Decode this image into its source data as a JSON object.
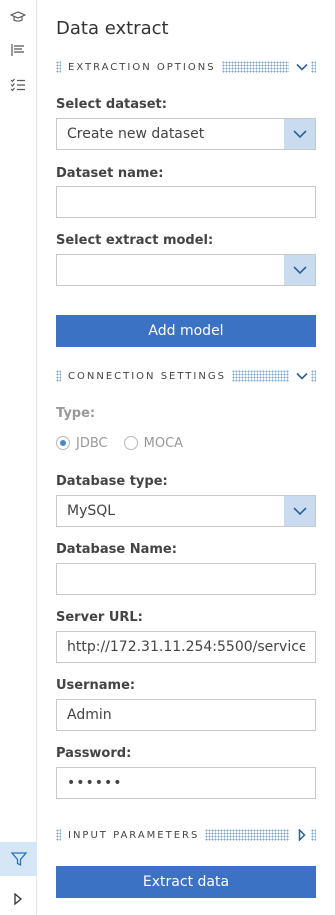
{
  "rail": {
    "icons": [
      "graduation-cap-icon",
      "list-flag-icon",
      "checklist-icon"
    ],
    "active": "filter-icon",
    "bottom": "play-icon"
  },
  "panel": {
    "title": "Data extract"
  },
  "extraction_options": {
    "header": "EXTRACTION OPTIONS",
    "select_dataset_label": "Select dataset:",
    "select_dataset_value": "Create new dataset",
    "dataset_name_label": "Dataset name:",
    "dataset_name_value": "",
    "select_model_label": "Select extract model:",
    "select_model_value": "",
    "add_model_button": "Add model"
  },
  "connection_settings": {
    "header": "CONNECTION SETTINGS",
    "type_label": "Type:",
    "type_options": [
      "JDBC",
      "MOCA"
    ],
    "type_selected": "JDBC",
    "database_type_label": "Database type:",
    "database_type_value": "MySQL",
    "database_name_label": "Database Name:",
    "database_name_value": "",
    "server_url_label": "Server URL:",
    "server_url_value": "http://172.31.11.254:5500/service",
    "username_label": "Username:",
    "username_value": "Admin",
    "password_label": "Password:",
    "password_value": "••••••"
  },
  "input_parameters": {
    "header": "INPUT PARAMETERS"
  },
  "extract_button": "Extract data",
  "colors": {
    "accent": "#3b72c4",
    "select_button": "#c9dcef",
    "active_rail": "#d5e6f7"
  }
}
